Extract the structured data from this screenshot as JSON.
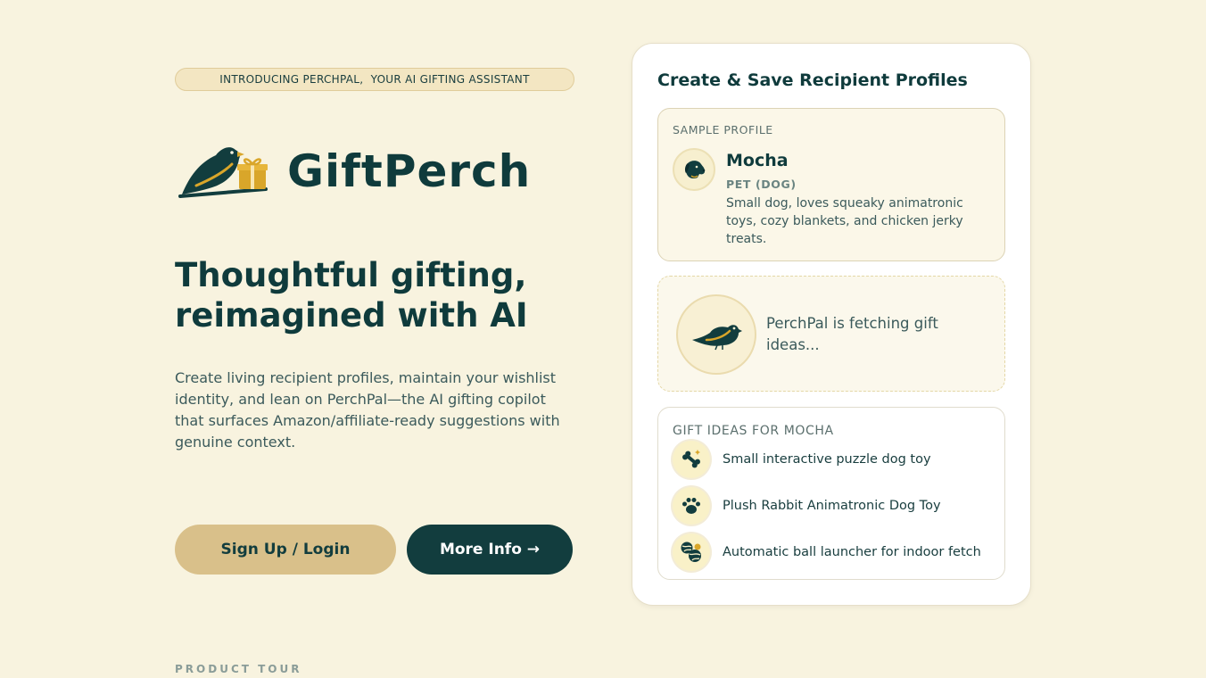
{
  "hero": {
    "badge": "INTRODUCING PERCHPAL,  YOUR AI GIFTING ASSISTANT",
    "brand": "GiftPerch",
    "headline": "Thoughtful gifting, reimagined with AI",
    "lede": "Create living recipient profiles, maintain your wishlist identity, and lean on PerchPal—the AI gifting copilot that surfaces Amazon/affiliate-ready suggestions with genuine context.",
    "signup_label": "Sign Up / Login",
    "more_label": "More Info →",
    "tour_label": "PRODUCT TOUR"
  },
  "card": {
    "title": "Create & Save Recipient Profiles",
    "profile": {
      "sample_label": "SAMPLE PROFILE",
      "name": "Mocha",
      "type": "PET (DOG)",
      "description": "Small dog, loves squeaky animatronic toys, cozy blankets, and chicken jerky treats."
    },
    "fetching_text": "PerchPal is fetching gift ideas...",
    "ideas": {
      "label": "GIFT IDEAS FOR MOCHA",
      "items": [
        {
          "text": "Small interactive puzzle dog toy",
          "icon": "bone-icon"
        },
        {
          "text": "Plush Rabbit Animatronic Dog Toy",
          "icon": "paw-icon"
        },
        {
          "text": "Automatic ball launcher for indoor fetch",
          "icon": "ball-icon"
        }
      ]
    }
  },
  "colors": {
    "background": "#f8f3df",
    "primary": "#123d3e",
    "accent": "#d9c08a",
    "gold": "#d9a62a"
  }
}
